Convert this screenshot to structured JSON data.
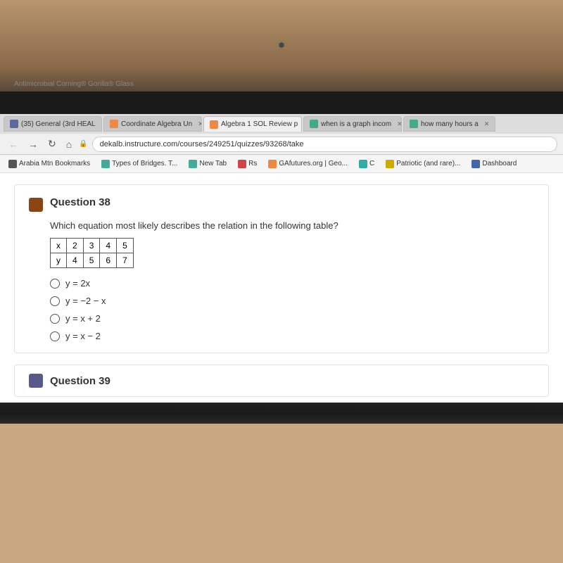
{
  "laptop": {
    "gorilla_text": "Antimicrobial Corning® Gorilla® Glass"
  },
  "browser": {
    "tabs": [
      {
        "id": "tab1",
        "label": "(35) General (3rd HEAL",
        "active": false,
        "icon_color": "#5a6a9a"
      },
      {
        "id": "tab2",
        "label": "Coordinate Algebra Un",
        "active": false,
        "icon_color": "#e84"
      },
      {
        "id": "tab3",
        "label": "Algebra 1 SOL Review p",
        "active": true,
        "icon_color": "#e84"
      },
      {
        "id": "tab4",
        "label": "when is a graph incom",
        "active": false,
        "icon_color": "#4a8"
      },
      {
        "id": "tab5",
        "label": "how many hours a",
        "active": false,
        "icon_color": "#4a8"
      }
    ],
    "url": "dekalb.instructure.com/courses/249251/quizzes/93268/take",
    "bookmarks": [
      {
        "id": "bm1",
        "label": "Arabia Mtn Bookmarks",
        "icon": "dark"
      },
      {
        "id": "bm2",
        "label": "Types of Bridges. T...",
        "icon": "green"
      },
      {
        "id": "bm3",
        "label": "New Tab",
        "icon": "green"
      },
      {
        "id": "bm4",
        "label": "Rs",
        "icon": "red"
      },
      {
        "id": "bm5",
        "label": "GAfutures.org | Geo...",
        "icon": "orange"
      },
      {
        "id": "bm6",
        "label": "C",
        "icon": "teal"
      },
      {
        "id": "bm7",
        "label": "Patriotic (and rare)...",
        "icon": "gold"
      },
      {
        "id": "bm8",
        "label": "Dashboard",
        "icon": "blue"
      }
    ]
  },
  "question38": {
    "number": "Question 38",
    "text": "Which equation most likely describes the relation in the following table?",
    "table": {
      "headers": [
        "x",
        "2",
        "3",
        "4",
        "5"
      ],
      "row2_label": "y",
      "row2_values": [
        "4",
        "5",
        "6",
        "7"
      ]
    },
    "options": [
      {
        "id": "opt1",
        "label": "y = 2x"
      },
      {
        "id": "opt2",
        "label": "y = −2 − x"
      },
      {
        "id": "opt3",
        "label": "y = x + 2"
      },
      {
        "id": "opt4",
        "label": "y = x − 2"
      }
    ]
  },
  "question39": {
    "number": "Question 39"
  }
}
